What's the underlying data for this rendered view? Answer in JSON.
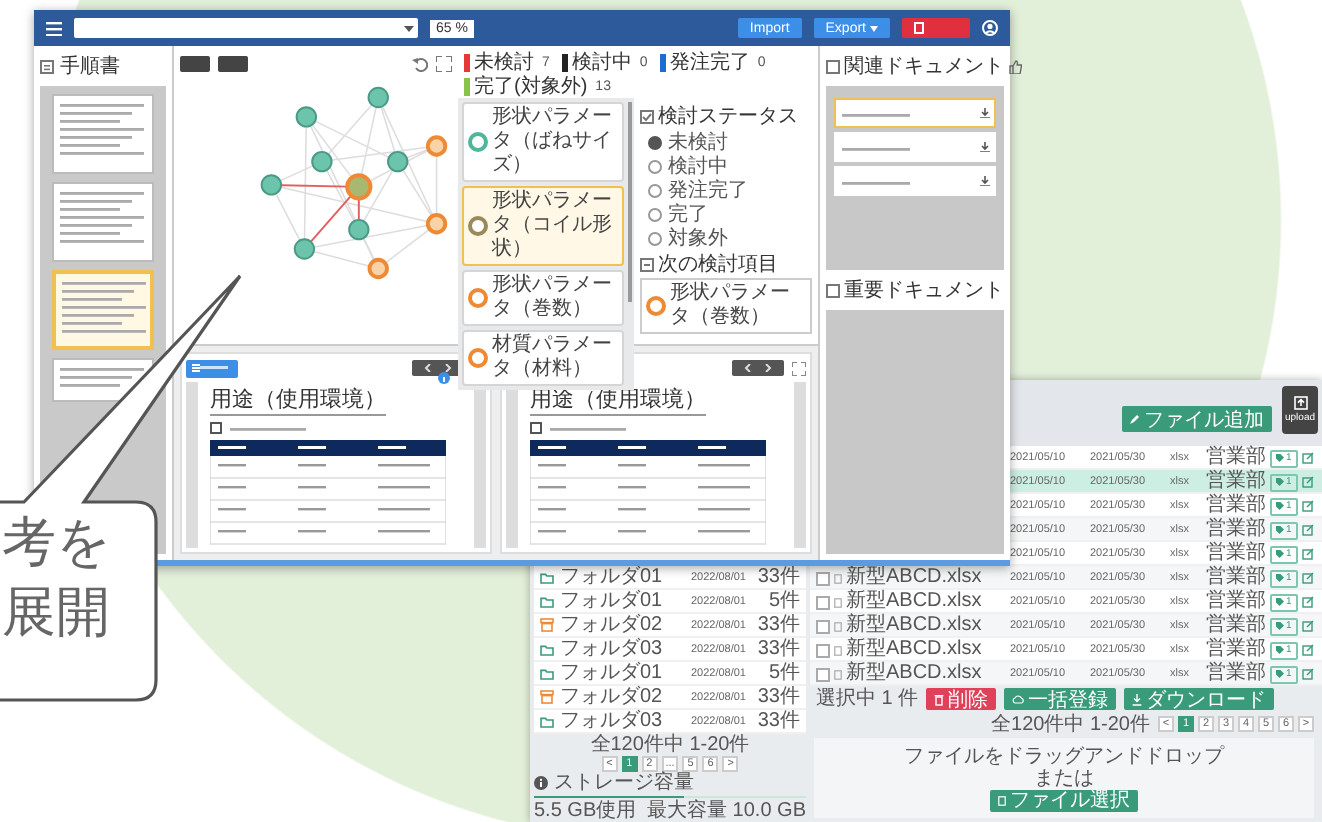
{
  "callout": {
    "lines": [
      "考を",
      "展開"
    ]
  },
  "editor": {
    "header": {
      "zoom": "65 %",
      "buttons": [
        {
          "kind": "import",
          "label": "Import"
        },
        {
          "kind": "export",
          "label": "Export"
        },
        {
          "kind": "alert"
        }
      ]
    },
    "manual": {
      "title": "手順書",
      "pages": [
        {
          "selected": false
        },
        {
          "selected": false
        },
        {
          "selected": true
        },
        {
          "selected": false
        }
      ]
    },
    "legend": [
      {
        "label": "未検討",
        "count": "7",
        "color": "#e53935"
      },
      {
        "label": "検討中",
        "count": "0",
        "color": "#222222"
      },
      {
        "label": "発注完了",
        "count": "0",
        "color": "#1e6bd6"
      },
      {
        "label": "完了(対象外)",
        "count": "13",
        "color": "#8bc34a"
      }
    ],
    "items": [
      {
        "label": "形状パラメータ（ばねサイズ）",
        "color": "#4fb59b",
        "selected": false
      },
      {
        "label": "形状パラメータ（コイル形状）",
        "color": "#9a8a5a",
        "selected": true
      },
      {
        "label": "形状パラメータ（巻数）",
        "color": "#ee8a35",
        "selected": false
      },
      {
        "label": "材質パラメータ（材料）",
        "color": "#ee8a35",
        "selected": false
      }
    ],
    "status": {
      "title": "検討ステータス",
      "options": [
        {
          "label": "未検討",
          "selected": true
        },
        {
          "label": "検討中",
          "selected": false
        },
        {
          "label": "発注完了",
          "selected": false
        },
        {
          "label": "完了",
          "selected": false
        },
        {
          "label": "対象外",
          "selected": false
        }
      ],
      "next_title": "次の検討項目",
      "next_item": {
        "label": "形状パラメータ（巻数）",
        "color": "#ee8a35"
      }
    },
    "viewers": [
      {
        "title": "用途（使用環境）"
      },
      {
        "title": "用途（使用環境）"
      }
    ],
    "related": {
      "title": "関連ドキュメント",
      "docs": [
        {
          "selected": true
        },
        {
          "selected": false
        },
        {
          "selected": false
        }
      ]
    },
    "important": {
      "title": "重要ドキュメント"
    }
  },
  "files": {
    "add_button": "ファイル追加",
    "upload_button": "upload",
    "rows": [
      {
        "created": "2021/05/10",
        "updated": "2021/05/30",
        "type": "xlsx",
        "dept": "営業部",
        "tags": "1",
        "selected": false
      },
      {
        "created": "2021/05/10",
        "updated": "2021/05/30",
        "type": "xlsx",
        "dept": "営業部",
        "tags": "1",
        "selected": true
      },
      {
        "created": "2021/05/10",
        "updated": "2021/05/30",
        "type": "xlsx",
        "dept": "営業部",
        "tags": "1",
        "selected": false
      },
      {
        "created": "2021/05/10",
        "updated": "2021/05/30",
        "type": "xlsx",
        "dept": "営業部",
        "tags": "1",
        "selected": false
      },
      {
        "created": "2021/05/10",
        "updated": "2021/05/30",
        "type": "xlsx",
        "dept": "営業部",
        "tags": "1",
        "selected": false
      },
      {
        "name": "新型ABCD.xlsx",
        "checked": false,
        "created": "2021/05/10",
        "updated": "2021/05/30",
        "type": "xlsx",
        "dept": "営業部",
        "tags": "1",
        "selected": false
      },
      {
        "name": "新型ABCD.xlsx",
        "checked": false,
        "created": "2021/05/10",
        "updated": "2021/05/30",
        "type": "xlsx",
        "dept": "営業部",
        "tags": "1",
        "selected": false
      },
      {
        "name": "新型ABCD.xlsx",
        "checked": false,
        "created": "2021/05/10",
        "updated": "2021/05/30",
        "type": "xlsx",
        "dept": "営業部",
        "tags": "1",
        "selected": false
      },
      {
        "name": "新型ABCD.xlsx",
        "checked": false,
        "created": "2021/05/10",
        "updated": "2021/05/30",
        "type": "xlsx",
        "dept": "営業部",
        "tags": "1",
        "selected": false
      },
      {
        "name": "新型ABCD.xlsx",
        "checked": false,
        "created": "2021/05/10",
        "updated": "2021/05/30",
        "type": "xlsx",
        "dept": "営業部",
        "tags": "1",
        "selected": false
      }
    ],
    "selection": "選択中 1 件",
    "actions": [
      {
        "kind": "delete",
        "label": "削除"
      },
      {
        "kind": "register",
        "label": "一括登録"
      },
      {
        "kind": "download",
        "label": "ダウンロード"
      }
    ],
    "pager": {
      "summary": "全120件中 1-20件",
      "pages": [
        {
          "label": "<",
          "selected": false
        },
        {
          "label": "1",
          "selected": true
        },
        {
          "label": "2",
          "selected": false
        },
        {
          "label": "3",
          "selected": false
        },
        {
          "label": "4",
          "selected": false
        },
        {
          "label": "5",
          "selected": false
        },
        {
          "label": "6",
          "selected": false
        },
        {
          "label": ">",
          "selected": false
        }
      ]
    },
    "dropzone": {
      "text": "ファイルをドラッグアンドドロップ",
      "or": "または",
      "button": "ファイル選択"
    },
    "folders": [
      {
        "name": "フォルダ01",
        "date": "2022/08/01",
        "count": "33件",
        "kind": "folder"
      },
      {
        "name": "フォルダ01",
        "date": "2022/08/01",
        "count": "5件",
        "kind": "folder"
      },
      {
        "name": "フォルダ02",
        "date": "2022/08/01",
        "count": "33件",
        "kind": "shared"
      },
      {
        "name": "フォルダ03",
        "date": "2022/08/01",
        "count": "33件",
        "kind": "folder"
      },
      {
        "name": "フォルダ01",
        "date": "2022/08/01",
        "count": "5件",
        "kind": "folder"
      },
      {
        "name": "フォルダ02",
        "date": "2022/08/01",
        "count": "33件",
        "kind": "shared"
      },
      {
        "name": "フォルダ03",
        "date": "2022/08/01",
        "count": "33件",
        "kind": "folder"
      }
    ],
    "folder_pager": {
      "summary": "全120件中 1-20件",
      "pages": [
        {
          "label": "<",
          "selected": false
        },
        {
          "label": "1",
          "selected": true
        },
        {
          "label": "2",
          "selected": false
        },
        {
          "label": "...",
          "selected": false
        },
        {
          "label": "5",
          "selected": false
        },
        {
          "label": "6",
          "selected": false
        },
        {
          "label": ">",
          "selected": false
        }
      ]
    },
    "storage": {
      "label": "ストレージ容量",
      "used": "5.5 GB使用",
      "max": "最大容量 10.0 GB",
      "level": 0.55
    }
  }
}
